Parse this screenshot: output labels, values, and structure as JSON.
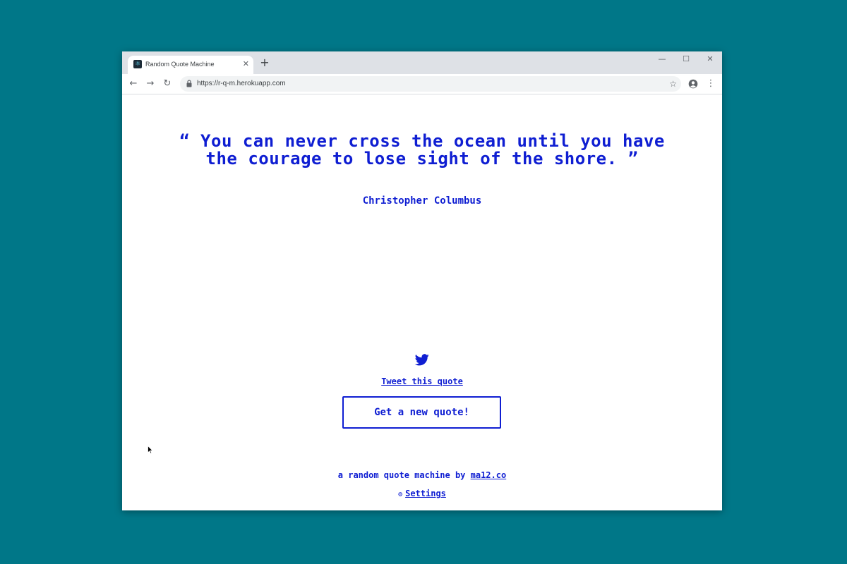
{
  "browser": {
    "tab_title": "Random Quote Machine",
    "tab_close": "✕",
    "new_tab": "+",
    "url": "https://r-q-m.herokuapp.com",
    "controls": {
      "minimize": "—",
      "maximize": "☐",
      "close": "✕"
    },
    "nav": {
      "back": "←",
      "forward": "→",
      "reload": "↻"
    },
    "star": "☆",
    "menu": "⋮"
  },
  "page": {
    "quote": "“ You can never cross the ocean until you have the courage to lose sight of the shore. ”",
    "author": "Christopher Columbus",
    "tweet_label": "Tweet this quote",
    "new_quote_label": "Get a new quote!",
    "footer_prefix": "a random quote machine by ",
    "footer_link": "ma12.co",
    "settings_icon": "⚙",
    "settings_label": "Settings"
  },
  "colors": {
    "accent": "#0f1ed2",
    "desktop": "#007788"
  },
  "icons": {
    "favicon": "react-atom-icon",
    "twitter": "twitter-bird-icon",
    "lock": "lock-icon",
    "profile": "account-circle-icon"
  }
}
